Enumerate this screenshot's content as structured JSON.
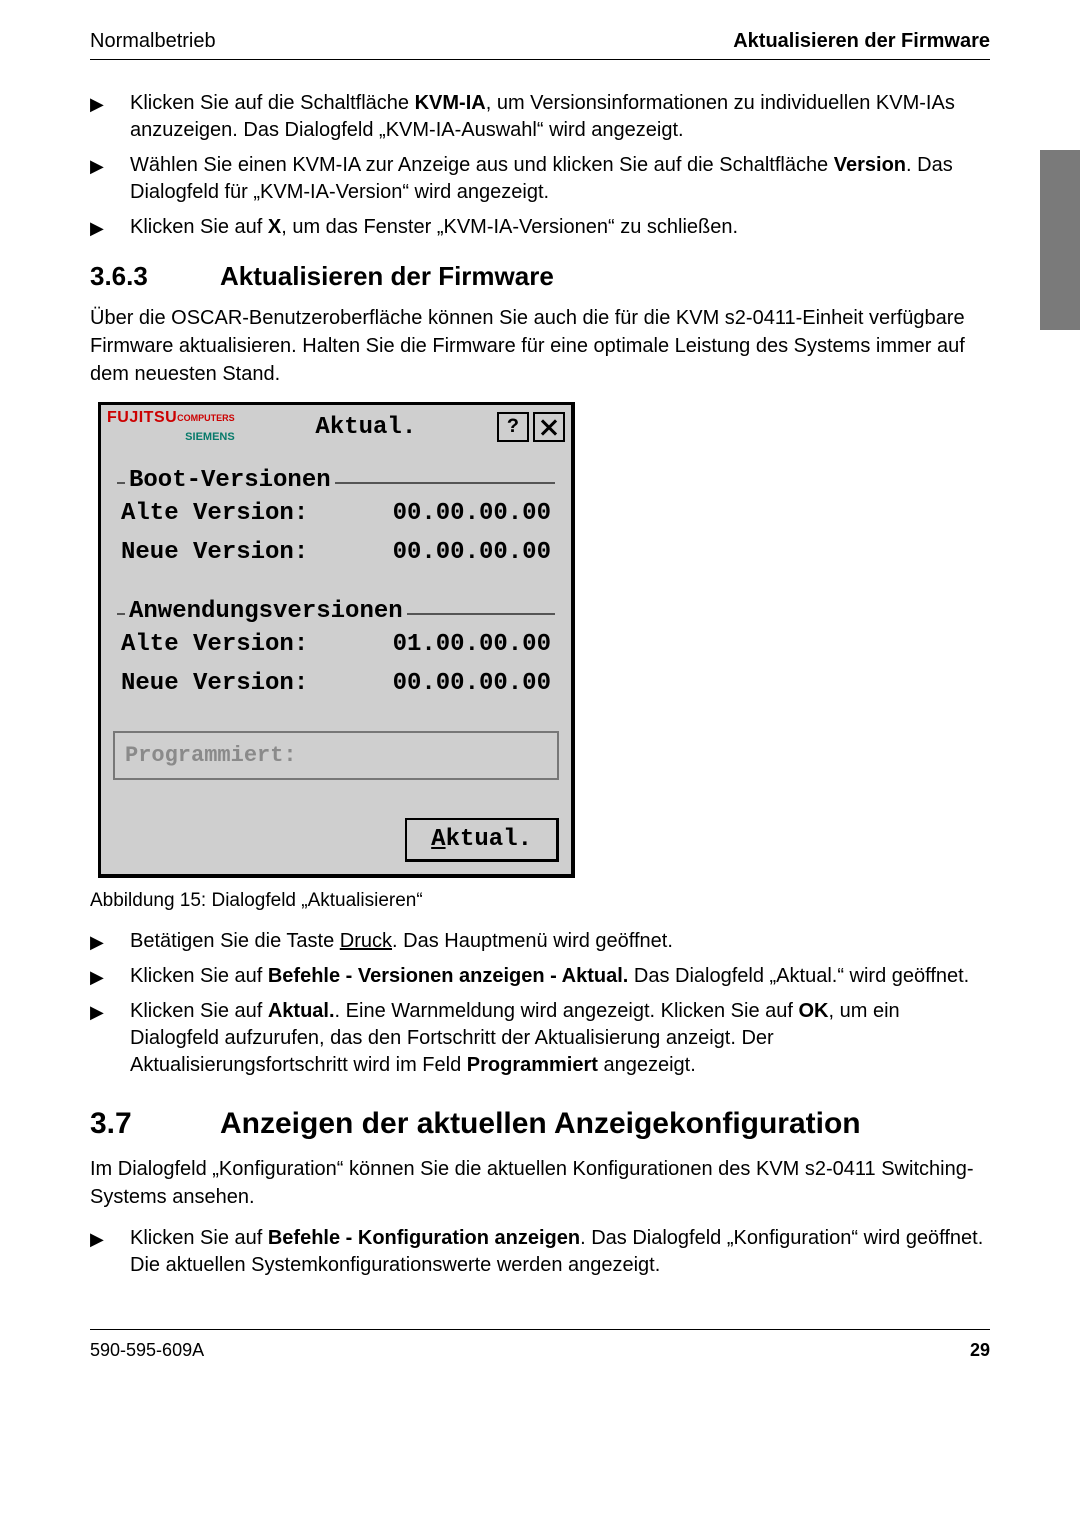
{
  "header": {
    "left": "Normalbetrieb",
    "right": "Aktualisieren der Firmware"
  },
  "intro_bullets": [
    {
      "parts": [
        {
          "t": "Klicken Sie auf die Schaltfläche "
        },
        {
          "t": "KVM-IA",
          "bold": true
        },
        {
          "t": ", um Versionsinformationen zu individuellen KVM-IAs anzuzeigen. Das Dialogfeld „KVM-IA-Auswahl“ wird angezeigt."
        }
      ]
    },
    {
      "parts": [
        {
          "t": "Wählen Sie einen KVM-IA zur Anzeige aus und klicken Sie auf die Schaltfläche "
        },
        {
          "t": "Version",
          "bold": true
        },
        {
          "t": ". Das Dialogfeld für „KVM-IA-Version“ wird angezeigt."
        }
      ]
    },
    {
      "parts": [
        {
          "t": "Klicken Sie auf "
        },
        {
          "t": "X",
          "bold": true
        },
        {
          "t": ", um das Fenster „KVM-IA-Versionen“ zu schließen."
        }
      ]
    }
  ],
  "section363": {
    "num": "3.6.3",
    "title": "Aktualisieren der Firmware",
    "para": "Über die OSCAR-Benutzeroberfläche können Sie auch die für die KVM s2-0411-Einheit verfügbare Firmware aktualisieren. Halten Sie die Firmware für eine optimale Leistung des Systems immer auf dem neuesten Stand."
  },
  "dialog": {
    "logo_text1": "FUJITSU",
    "logo_text2": "COMPUTERS",
    "logo_text3": "SIEMENS",
    "title": "Aktual.",
    "help_label": "?",
    "boot_group": "Boot-Versionen",
    "app_group": "Anwendungsversionen",
    "old_label": "Alte Version:",
    "new_label": "Neue Version:",
    "boot_old": "00.00.00.00",
    "boot_new": "00.00.00.00",
    "app_old": "01.00.00.00",
    "app_new": "00.00.00.00",
    "programmed": "Programmiert:",
    "action_u": "A",
    "action_rest": "ktual."
  },
  "figure_caption": "Abbildung 15: Dialogfeld „Aktualisieren“",
  "post_bullets": [
    {
      "parts": [
        {
          "t": "Betätigen Sie die Taste "
        },
        {
          "t": "Druck",
          "underline": true
        },
        {
          "t": ". Das Hauptmenü wird geöffnet."
        }
      ]
    },
    {
      "parts": [
        {
          "t": "Klicken Sie auf "
        },
        {
          "t": "Befehle - Versionen anzeigen - Aktual.",
          "bold": true
        },
        {
          "t": " Das Dialogfeld „Aktual.“ wird geöffnet."
        }
      ]
    },
    {
      "parts": [
        {
          "t": "Klicken Sie auf "
        },
        {
          "t": "Aktual.",
          "bold": true
        },
        {
          "t": ". Eine Warnmeldung wird angezeigt. Klicken Sie auf "
        },
        {
          "t": "OK",
          "bold": true
        },
        {
          "t": ", um ein Dialogfeld aufzurufen, das den Fortschritt der Aktualisierung anzeigt. Der Aktualisierungsfortschritt wird im Feld "
        },
        {
          "t": "Programmiert",
          "bold": true
        },
        {
          "t": " angezeigt."
        }
      ]
    }
  ],
  "section37": {
    "num": "3.7",
    "title": "Anzeigen der aktuellen Anzeigekonfiguration",
    "para": "Im Dialogfeld „Konfiguration“ können Sie die aktuellen Konfigurationen des KVM s2-0411 Switching-Systems ansehen."
  },
  "final_bullets": [
    {
      "parts": [
        {
          "t": "Klicken Sie auf "
        },
        {
          "t": "Befehle - Konfiguration anzeigen",
          "bold": true
        },
        {
          "t": ". Das Dialogfeld „Konfiguration“ wird geöffnet. Die aktuellen Systemkonfigurationswerte werden angezeigt."
        }
      ]
    }
  ],
  "footer": {
    "doc_id": "590-595-609A",
    "page": "29"
  }
}
